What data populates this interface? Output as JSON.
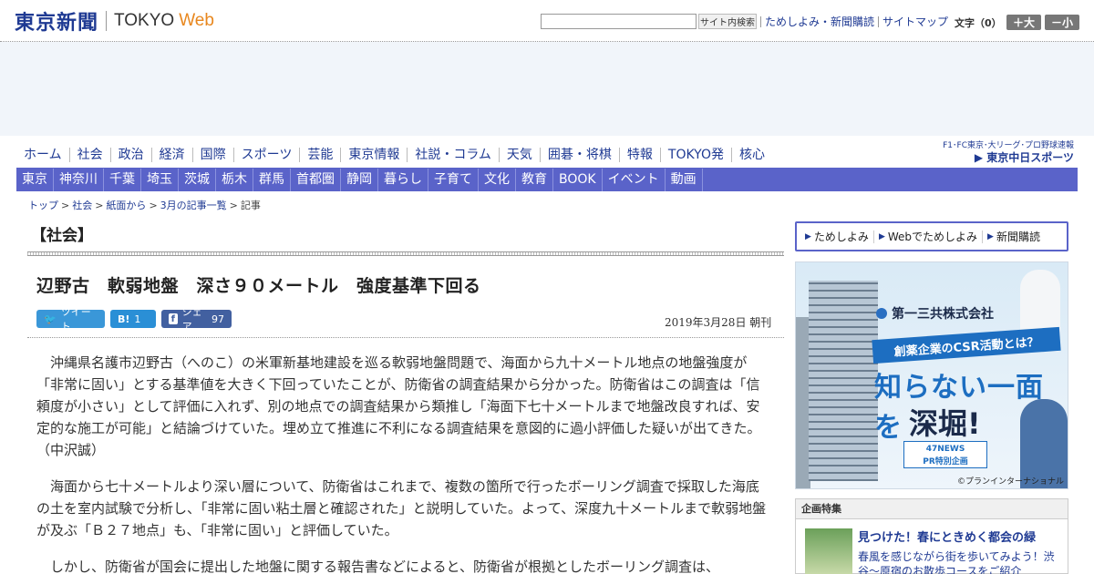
{
  "header": {
    "logo_jp": "東京新聞",
    "logo_en": "TOKYO",
    "logo_web": "Web",
    "search_button": "サイト内検索",
    "links": [
      "ためしよみ・新聞購読",
      "サイトマップ"
    ],
    "font_label": "文字（0）",
    "font_up": "＋大",
    "font_down": "－小"
  },
  "nav1": {
    "items": [
      "ホーム",
      "社会",
      "政治",
      "経済",
      "国際",
      "スポーツ",
      "芸能",
      "東京情報",
      "社説・コラム",
      "天気",
      "囲碁・将棋",
      "特報",
      "TOKYO発",
      "核心"
    ],
    "chunichi_top": "F1･FC東京･大リーグ･プロ野球速報",
    "chunichi_bottom": "▶ 東京中日スポーツ"
  },
  "nav2": {
    "items": [
      "東京",
      "神奈川",
      "千葉",
      "埼玉",
      "茨城",
      "栃木",
      "群馬",
      "首都圏",
      "静岡",
      "暮らし",
      "子育て",
      "文化",
      "教育",
      "BOOK",
      "イベント",
      "動画"
    ]
  },
  "breadcrumb": [
    "トップ",
    "社会",
    "紙面から",
    "3月の記事一覧",
    "記事"
  ],
  "section_title": "【社会】",
  "article": {
    "title": "辺野古　軟弱地盤　深さ９０メートル　強度基準下回る",
    "tweet": "ツイート",
    "hatena_icon": "B!",
    "hatena_count": "1",
    "facebook": "シェア",
    "facebook_count": "97",
    "date": "2019年3月28日 朝刊",
    "paragraphs": [
      "沖縄県名護市辺野古（へのこ）の米軍新基地建設を巡る軟弱地盤問題で、海面から九十メートル地点の地盤強度が「非常に固い」とする基準値を大きく下回っていたことが、防衛省の調査結果から分かった。防衛省はこの調査は「信頼度が小さい」として評価に入れず、別の地点での調査結果から類推し「海面下七十メートルまで地盤改良すれば、安定的な施工が可能」と結論づけていた。埋め立て推進に不利になる調査結果を意図的に過小評価した疑いが出てきた。　（中沢誠）",
      "海面から七十メートルより深い層について、防衛省はこれまで、複数の箇所で行ったボーリング調査で採取した海底の土を室内試験で分析し、「非常に固い粘土層と確認された」と説明していた。よって、深度九十メートルまで軟弱地盤が及ぶ「Ｂ２７地点」も、「非常に固い」と評価していた。",
      "しかし、防衛省が国会に提出した地盤に関する報告書などによると、防衛省が根拠としたボーリング調査は、"
    ]
  },
  "sidebar": {
    "promo": [
      "ためしよみ",
      "Webでためしよみ",
      "新聞購読"
    ],
    "ad": {
      "company": "第一三共株式会社",
      "ribbon": "創薬企業のCSR活動とは？",
      "headline1": "知らない一面を",
      "headline2": "深堀!",
      "badge1": "47NEWS",
      "badge2": "PR特別企画",
      "credit": "©プランインターナショナル"
    },
    "feature": {
      "heading": "企画特集",
      "title": "見つけた！春にときめく都会の緑",
      "desc": "春風を感じながら街を歩いてみよう！渋谷～原宿のお散歩コースをご紹介"
    }
  }
}
